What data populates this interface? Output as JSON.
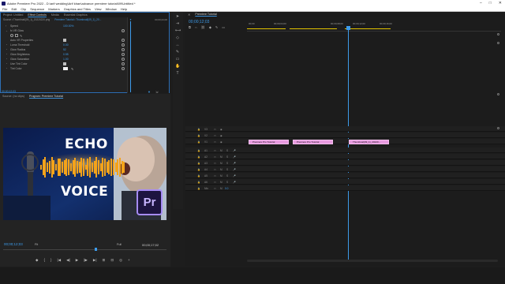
{
  "window": {
    "title": "Adobe Premiere Pro 2022 - D:\\arif wedding\\Arif khan\\advance premiere tutorial\\09\\Untitled *",
    "controls": [
      "–",
      "□",
      "✕"
    ]
  },
  "menu": [
    "File",
    "Edit",
    "Clip",
    "Sequence",
    "Markers",
    "Graphics and Titles",
    "View",
    "Window",
    "Help"
  ],
  "effect_controls": {
    "tabs": [
      "Project: Untitled",
      "Effect Controls",
      "Media",
      "Essential Graphics"
    ],
    "active_tab": "Effect Controls",
    "source_label": "Source • Thumbnail(09_1)_20220220.png",
    "seq_label": "Premiere Tutorial • Thumbnail(09_1)_20...",
    "header_time": "00;00;00;00",
    "end_time": "00;00;24;00",
    "rows": [
      {
        "label": "Speed",
        "value": "100.00%"
      },
      {
        "label": "fx  VR Glow",
        "value": ""
      },
      {
        "label": "Auto VR Properties",
        "value": "check"
      },
      {
        "label": "Luma Threshold",
        "value": "0.00"
      },
      {
        "label": "Glow Radius",
        "value": "52"
      },
      {
        "label": "Glow Brightness",
        "value": "0.55"
      },
      {
        "label": "Glow Saturation",
        "value": "1.00"
      },
      {
        "label": "Use Tint Color",
        "value": "check"
      },
      {
        "label": "Tint Color",
        "value": "swatch"
      }
    ],
    "footer_time": "00;00;12;03"
  },
  "program": {
    "tabs": [
      "Source: (no clips)",
      "Program: Premiere Tutorial"
    ],
    "active_tab": "Program: Premiere Tutorial",
    "thumbnail_text": [
      "ECHO",
      "VOICE"
    ],
    "pr_logo": "Pr",
    "current_time": "00;00;12;03",
    "fit": "Fit",
    "quality": "Full",
    "duration": "00;00;17;02",
    "transport_icons": [
      "◆",
      "{",
      "}",
      "|◀",
      "◀|",
      "▶",
      "|▶",
      "▶|",
      "⊞",
      "⊟",
      "◎",
      "+"
    ]
  },
  "timeline": {
    "tab": "Premiere Tutorial",
    "current_time": "00;00;12;03",
    "ruler": [
      "00;00",
      "00;00;04;00",
      "00;00;08;00",
      "00;00;12;00",
      "00;00;16;00"
    ],
    "tracks": [
      {
        "name": "V3",
        "type": "video"
      },
      {
        "name": "V2",
        "type": "video"
      },
      {
        "name": "V1",
        "type": "video"
      },
      {
        "name": "A1",
        "type": "audio"
      },
      {
        "name": "A2",
        "type": "audio"
      },
      {
        "name": "A3",
        "type": "audio"
      },
      {
        "name": "A4",
        "type": "audio"
      },
      {
        "name": "A5",
        "type": "audio"
      },
      {
        "name": "A6",
        "type": "audio"
      },
      {
        "name": "Mix",
        "type": "mix",
        "value": "0.0"
      }
    ],
    "clips": [
      "Premiere Pro Tutorial",
      "Premiere Pro Tutorial",
      "Thumbnail(09_1)_20220..."
    ],
    "colors": {
      "clip": "#e89ae0",
      "accent": "#3d9bea",
      "playhead": "#3d9bea"
    }
  },
  "icons": {
    "tools": [
      "selection-tool",
      "track-select-tool",
      "ripple-edit-tool",
      "razor-tool",
      "slip-tool",
      "pen-tool",
      "rectangle-tool",
      "hand-tool",
      "type-tool"
    ]
  }
}
